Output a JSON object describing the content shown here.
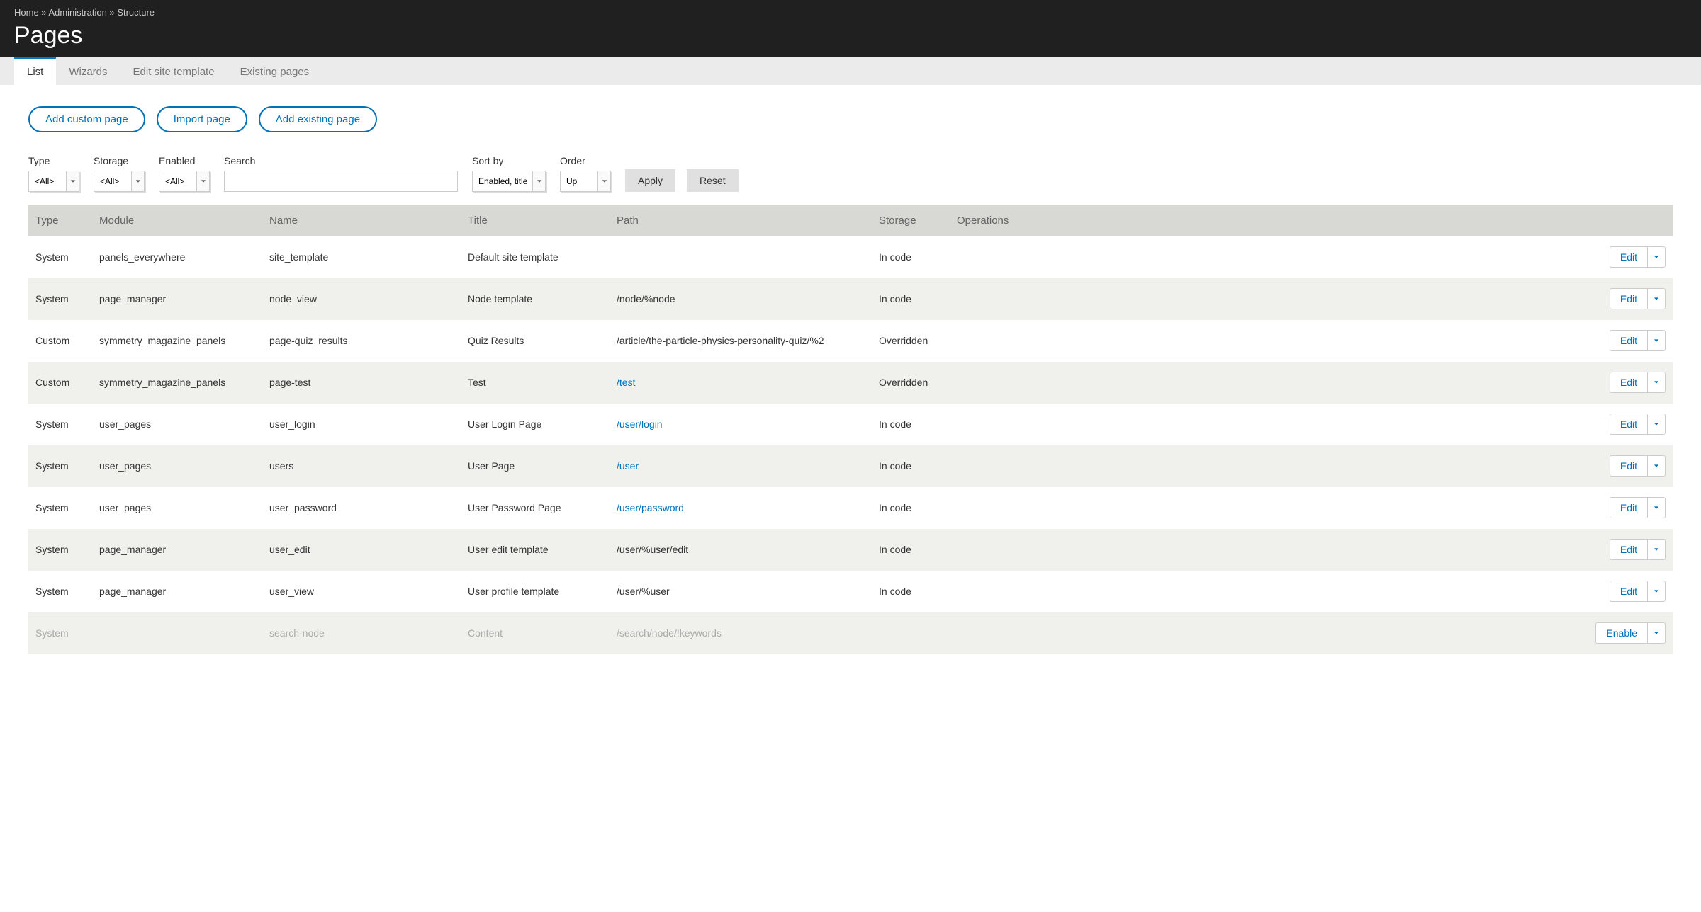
{
  "breadcrumb": [
    {
      "label": "Home"
    },
    {
      "label": "Administration"
    },
    {
      "label": "Structure"
    }
  ],
  "breadcrumb_separator": " » ",
  "page_title": "Pages",
  "tabs": [
    {
      "label": "List",
      "active": true
    },
    {
      "label": "Wizards",
      "active": false
    },
    {
      "label": "Edit site template",
      "active": false
    },
    {
      "label": "Existing pages",
      "active": false
    }
  ],
  "actions": {
    "add_custom": "Add custom page",
    "import": "Import page",
    "add_existing": "Add existing page"
  },
  "filters": {
    "type": {
      "label": "Type",
      "value": "<All>"
    },
    "storage": {
      "label": "Storage",
      "value": "<All>"
    },
    "enabled": {
      "label": "Enabled",
      "value": "<All>"
    },
    "search": {
      "label": "Search",
      "value": ""
    },
    "sort_by": {
      "label": "Sort by",
      "value": "Enabled, title"
    },
    "order": {
      "label": "Order",
      "value": "Up"
    },
    "apply": "Apply",
    "reset": "Reset"
  },
  "columns": {
    "type": "Type",
    "module": "Module",
    "name": "Name",
    "title": "Title",
    "path": "Path",
    "storage": "Storage",
    "operations": "Operations"
  },
  "rows": [
    {
      "type": "System",
      "module": "panels_everywhere",
      "name": "site_template",
      "title": "Default site template",
      "path": "",
      "path_link": false,
      "storage": "In code",
      "op": "Edit",
      "disabled": false
    },
    {
      "type": "System",
      "module": "page_manager",
      "name": "node_view",
      "title": "Node template",
      "path": "/node/%node",
      "path_link": false,
      "storage": "In code",
      "op": "Edit",
      "disabled": false
    },
    {
      "type": "Custom",
      "module": "symmetry_magazine_panels",
      "name": "page-quiz_results",
      "title": "Quiz Results",
      "path": "/article/the-particle-physics-personality-quiz/%2",
      "path_link": false,
      "storage": "Overridden",
      "op": "Edit",
      "disabled": false
    },
    {
      "type": "Custom",
      "module": "symmetry_magazine_panels",
      "name": "page-test",
      "title": "Test",
      "path": "/test",
      "path_link": true,
      "storage": "Overridden",
      "op": "Edit",
      "disabled": false
    },
    {
      "type": "System",
      "module": "user_pages",
      "name": "user_login",
      "title": "User Login Page",
      "path": "/user/login",
      "path_link": true,
      "storage": "In code",
      "op": "Edit",
      "disabled": false
    },
    {
      "type": "System",
      "module": "user_pages",
      "name": "users",
      "title": "User Page",
      "path": "/user",
      "path_link": true,
      "storage": "In code",
      "op": "Edit",
      "disabled": false
    },
    {
      "type": "System",
      "module": "user_pages",
      "name": "user_password",
      "title": "User Password Page",
      "path": "/user/password",
      "path_link": true,
      "storage": "In code",
      "op": "Edit",
      "disabled": false
    },
    {
      "type": "System",
      "module": "page_manager",
      "name": "user_edit",
      "title": "User edit template",
      "path": "/user/%user/edit",
      "path_link": false,
      "storage": "In code",
      "op": "Edit",
      "disabled": false
    },
    {
      "type": "System",
      "module": "page_manager",
      "name": "user_view",
      "title": "User profile template",
      "path": "/user/%user",
      "path_link": false,
      "storage": "In code",
      "op": "Edit",
      "disabled": false
    },
    {
      "type": "System",
      "module": "",
      "name": "search-node",
      "title": "Content",
      "path": "/search/node/!keywords",
      "path_link": false,
      "storage": "",
      "op": "Enable",
      "disabled": true
    }
  ]
}
